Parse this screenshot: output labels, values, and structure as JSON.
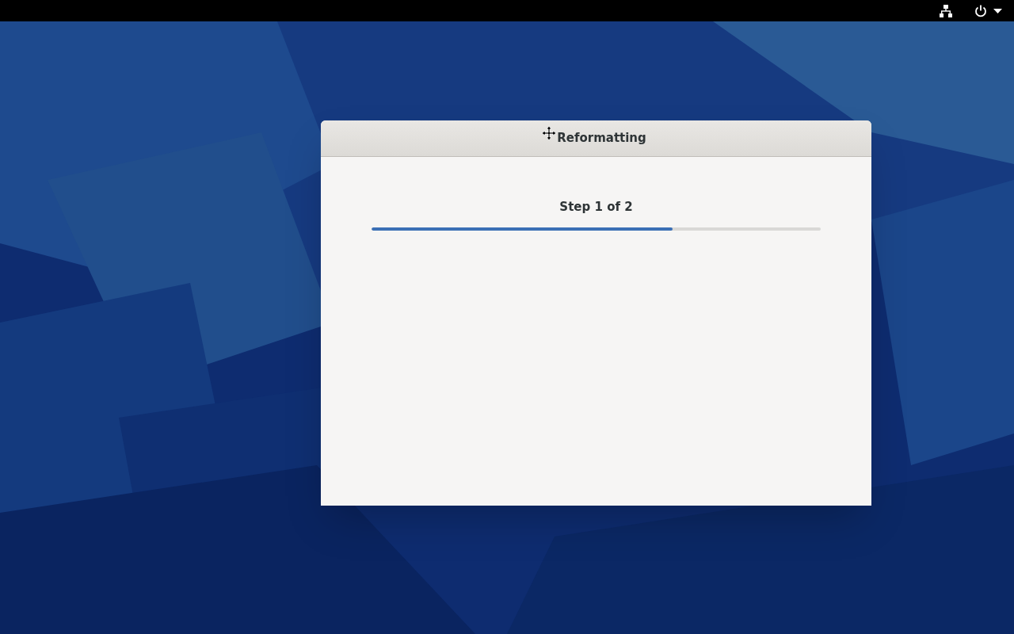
{
  "top_bar": {
    "indicators": [
      {
        "kind": "network"
      },
      {
        "kind": "power"
      }
    ]
  },
  "dialog": {
    "title": "Reformatting",
    "step": "Step 1 of 2",
    "progress": {
      "level": 0.67
    }
  }
}
